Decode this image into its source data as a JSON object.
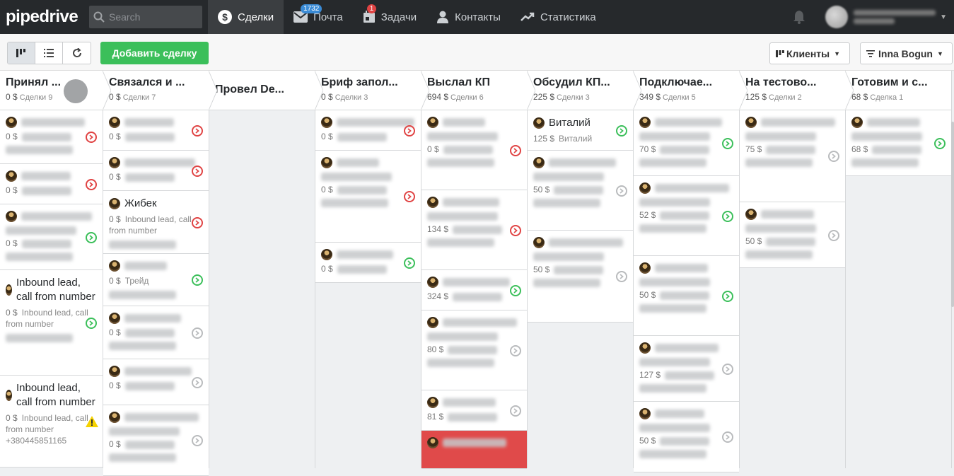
{
  "app": {
    "logo": "pipedrive",
    "search_placeholder": "Search"
  },
  "nav": [
    {
      "label": "Сделки",
      "icon": "dollar-icon",
      "active": true
    },
    {
      "label": "Почта",
      "icon": "mail-icon",
      "badge": "1732"
    },
    {
      "label": "Задачи",
      "icon": "calendar-icon",
      "badge": "1"
    },
    {
      "label": "Контакты",
      "icon": "person-icon"
    },
    {
      "label": "Статистика",
      "icon": "trend-icon"
    }
  ],
  "toolbar": {
    "add_deal": "Добавить сделку",
    "filter_clients": "Клиенты",
    "filter_owner": "Inna Bogun"
  },
  "stages": [
    {
      "name": "Принял ...",
      "sum": "0 $",
      "count": "Сделки 9",
      "cards": [
        {
          "status": "r",
          "price": "0 $"
        },
        {
          "status": "r",
          "price": "0 $"
        },
        {
          "status": "g",
          "price": "0 $"
        },
        {
          "status": "g",
          "title": "Inbound lead, call from number",
          "price": "0 $",
          "sub": "Inbound lead, call from number"
        },
        {
          "status": "w",
          "title": "Inbound lead, call from number",
          "price": "0 $",
          "sub": "Inbound lead, call from number",
          "extra": "+380445851165"
        }
      ]
    },
    {
      "name": "Связался и ...",
      "sum": "0 $",
      "count": "Сделки 7",
      "cards": [
        {
          "status": "r",
          "price": "0 $"
        },
        {
          "status": "r",
          "price": "0 $"
        },
        {
          "status": "r",
          "title": "Жибек",
          "price": "0 $",
          "sub": "Inbound lead, call from number"
        },
        {
          "status": "g",
          "price": "0 $",
          "sub": "Трейд"
        },
        {
          "status": "n",
          "price": "0 $"
        },
        {
          "status": "n",
          "price": "0 $"
        },
        {
          "status": "n",
          "price": "0 $"
        }
      ]
    },
    {
      "name": "Провел De...",
      "sum": "",
      "count": "",
      "cards": []
    },
    {
      "name": "Бриф запол...",
      "sum": "0 $",
      "count": "Сделки 3",
      "cards": [
        {
          "status": "r",
          "price": "0 $"
        },
        {
          "status": "r",
          "price": "0 $"
        },
        {
          "status": "g",
          "price": "0 $"
        }
      ]
    },
    {
      "name": "Выслал КП",
      "sum": "694 $",
      "count": "Сделки 6",
      "cards": [
        {
          "status": "r",
          "price": "0 $"
        },
        {
          "status": "r",
          "price": "134 $"
        },
        {
          "status": "g",
          "price": "324 $"
        },
        {
          "status": "n",
          "price": "80 $"
        },
        {
          "status": "n",
          "price": "81 $"
        },
        {
          "status": "x",
          "price": ""
        }
      ]
    },
    {
      "name": "Обсудил КП...",
      "sum": "225 $",
      "count": "Сделки 3",
      "cards": [
        {
          "status": "g",
          "title": "Виталий",
          "price": "125 $",
          "sub": "Виталий"
        },
        {
          "status": "n",
          "price": "50 $"
        },
        {
          "status": "n",
          "price": "50 $"
        }
      ]
    },
    {
      "name": "Подключае...",
      "sum": "349 $",
      "count": "Сделки 5",
      "cards": [
        {
          "status": "g",
          "price": "70 $"
        },
        {
          "status": "g",
          "price": "52 $"
        },
        {
          "status": "g",
          "price": "50 $"
        },
        {
          "status": "n",
          "price": "127 $"
        },
        {
          "status": "n",
          "price": "50 $"
        }
      ]
    },
    {
      "name": "На тестово...",
      "sum": "125 $",
      "count": "Сделки 2",
      "cards": [
        {
          "status": "n",
          "price": "75 $"
        },
        {
          "status": "n",
          "price": "50 $"
        }
      ]
    },
    {
      "name": "Готовим и с...",
      "sum": "68 $",
      "count": "Сделка 1",
      "cards": [
        {
          "status": "g",
          "price": "68 $"
        }
      ]
    }
  ]
}
